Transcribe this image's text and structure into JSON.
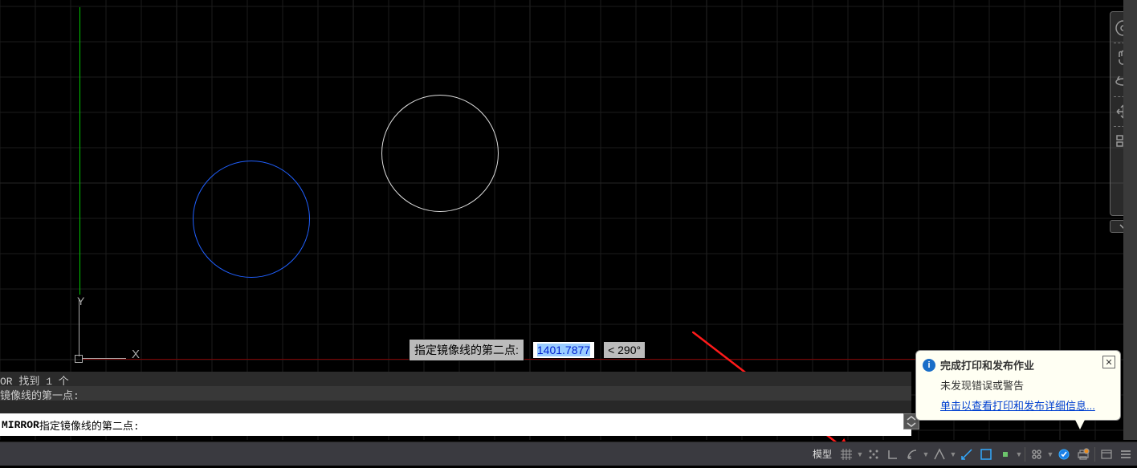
{
  "canvas": {
    "dyn_prompt_label": "指定镜像线的第二点:",
    "dyn_distance": "1401.7877",
    "dyn_angle": "< 290°"
  },
  "cmd": {
    "history_line": "OR 找到 1 个",
    "prompt_line": "镜像线的第一点:",
    "input_prefix": "MIRROR ",
    "input_rest": "指定镜像线的第二点:"
  },
  "balloon": {
    "title": "完成打印和发布作业",
    "message": "未发现错误或警告",
    "link": "单击以查看打印和发布详细信息..."
  },
  "status": {
    "model": "模型"
  },
  "ucs": {
    "y_label": "Y",
    "x_label": "X"
  },
  "nav": {
    "items": [
      "wheel-icon",
      "pan-icon",
      "orbit-icon",
      "show-motion-icon"
    ]
  }
}
